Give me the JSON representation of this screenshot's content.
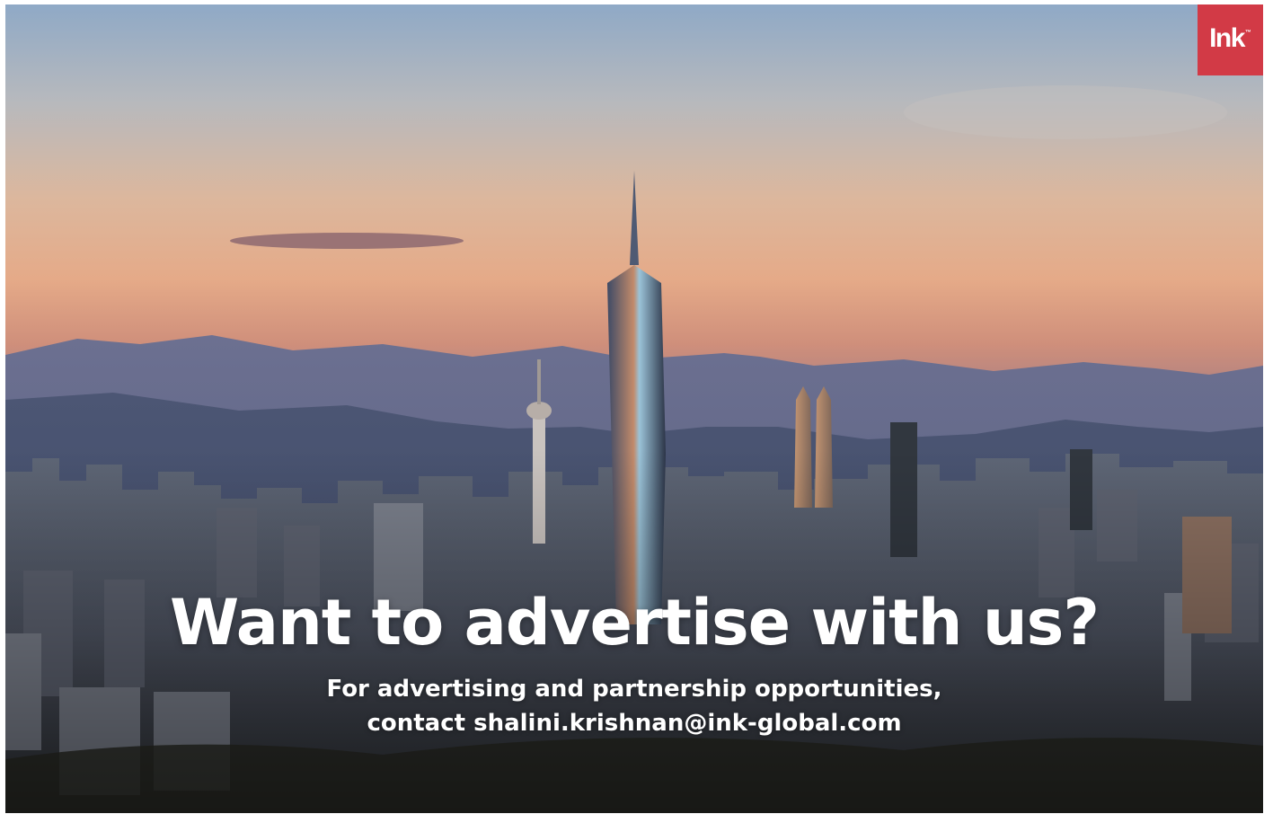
{
  "advert": {
    "headline": "Want to advertise with us?",
    "line1": "For advertising and partnership opportunities,",
    "line2": "contact shalini.krishnan@ink-global.com"
  },
  "brand": {
    "logo_text": "Ink",
    "color": "#d23a46"
  },
  "image": {
    "subject": "city-skyline-at-sunset-photo"
  }
}
